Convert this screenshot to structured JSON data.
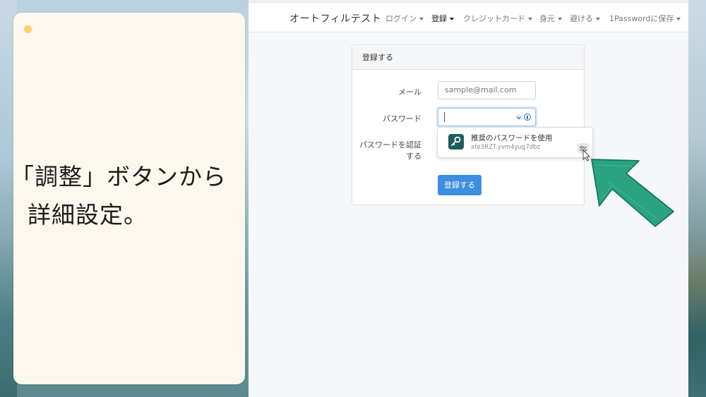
{
  "note": {
    "line1": "「調整」ボタンから",
    "line2": "詳細設定。"
  },
  "navbar": {
    "brand": "オートフィルテスト",
    "items": [
      {
        "label": "ログイン",
        "active": false
      },
      {
        "label": "登録",
        "active": true
      },
      {
        "label": "クレジットカード",
        "active": false
      },
      {
        "label": "身元",
        "active": false
      },
      {
        "label": "避ける",
        "active": false
      },
      {
        "label": "1Passwordに保存",
        "active": false
      }
    ]
  },
  "form": {
    "header": "登録する",
    "email_label": "メール",
    "email_placeholder": "sample@mail.com",
    "password_label": "パスワード",
    "confirm_label_line1": "パスワードを認証",
    "confirm_label_line2": "する",
    "submit_label": "登録する"
  },
  "popup": {
    "title": "推奨のパスワードを使用",
    "suggested_password": "ate3RZT.yvm4yug7dbz"
  },
  "colors": {
    "accent": "#3b8ee0",
    "key_badge": "#1f5d5c",
    "arrow": "#2aa381"
  }
}
